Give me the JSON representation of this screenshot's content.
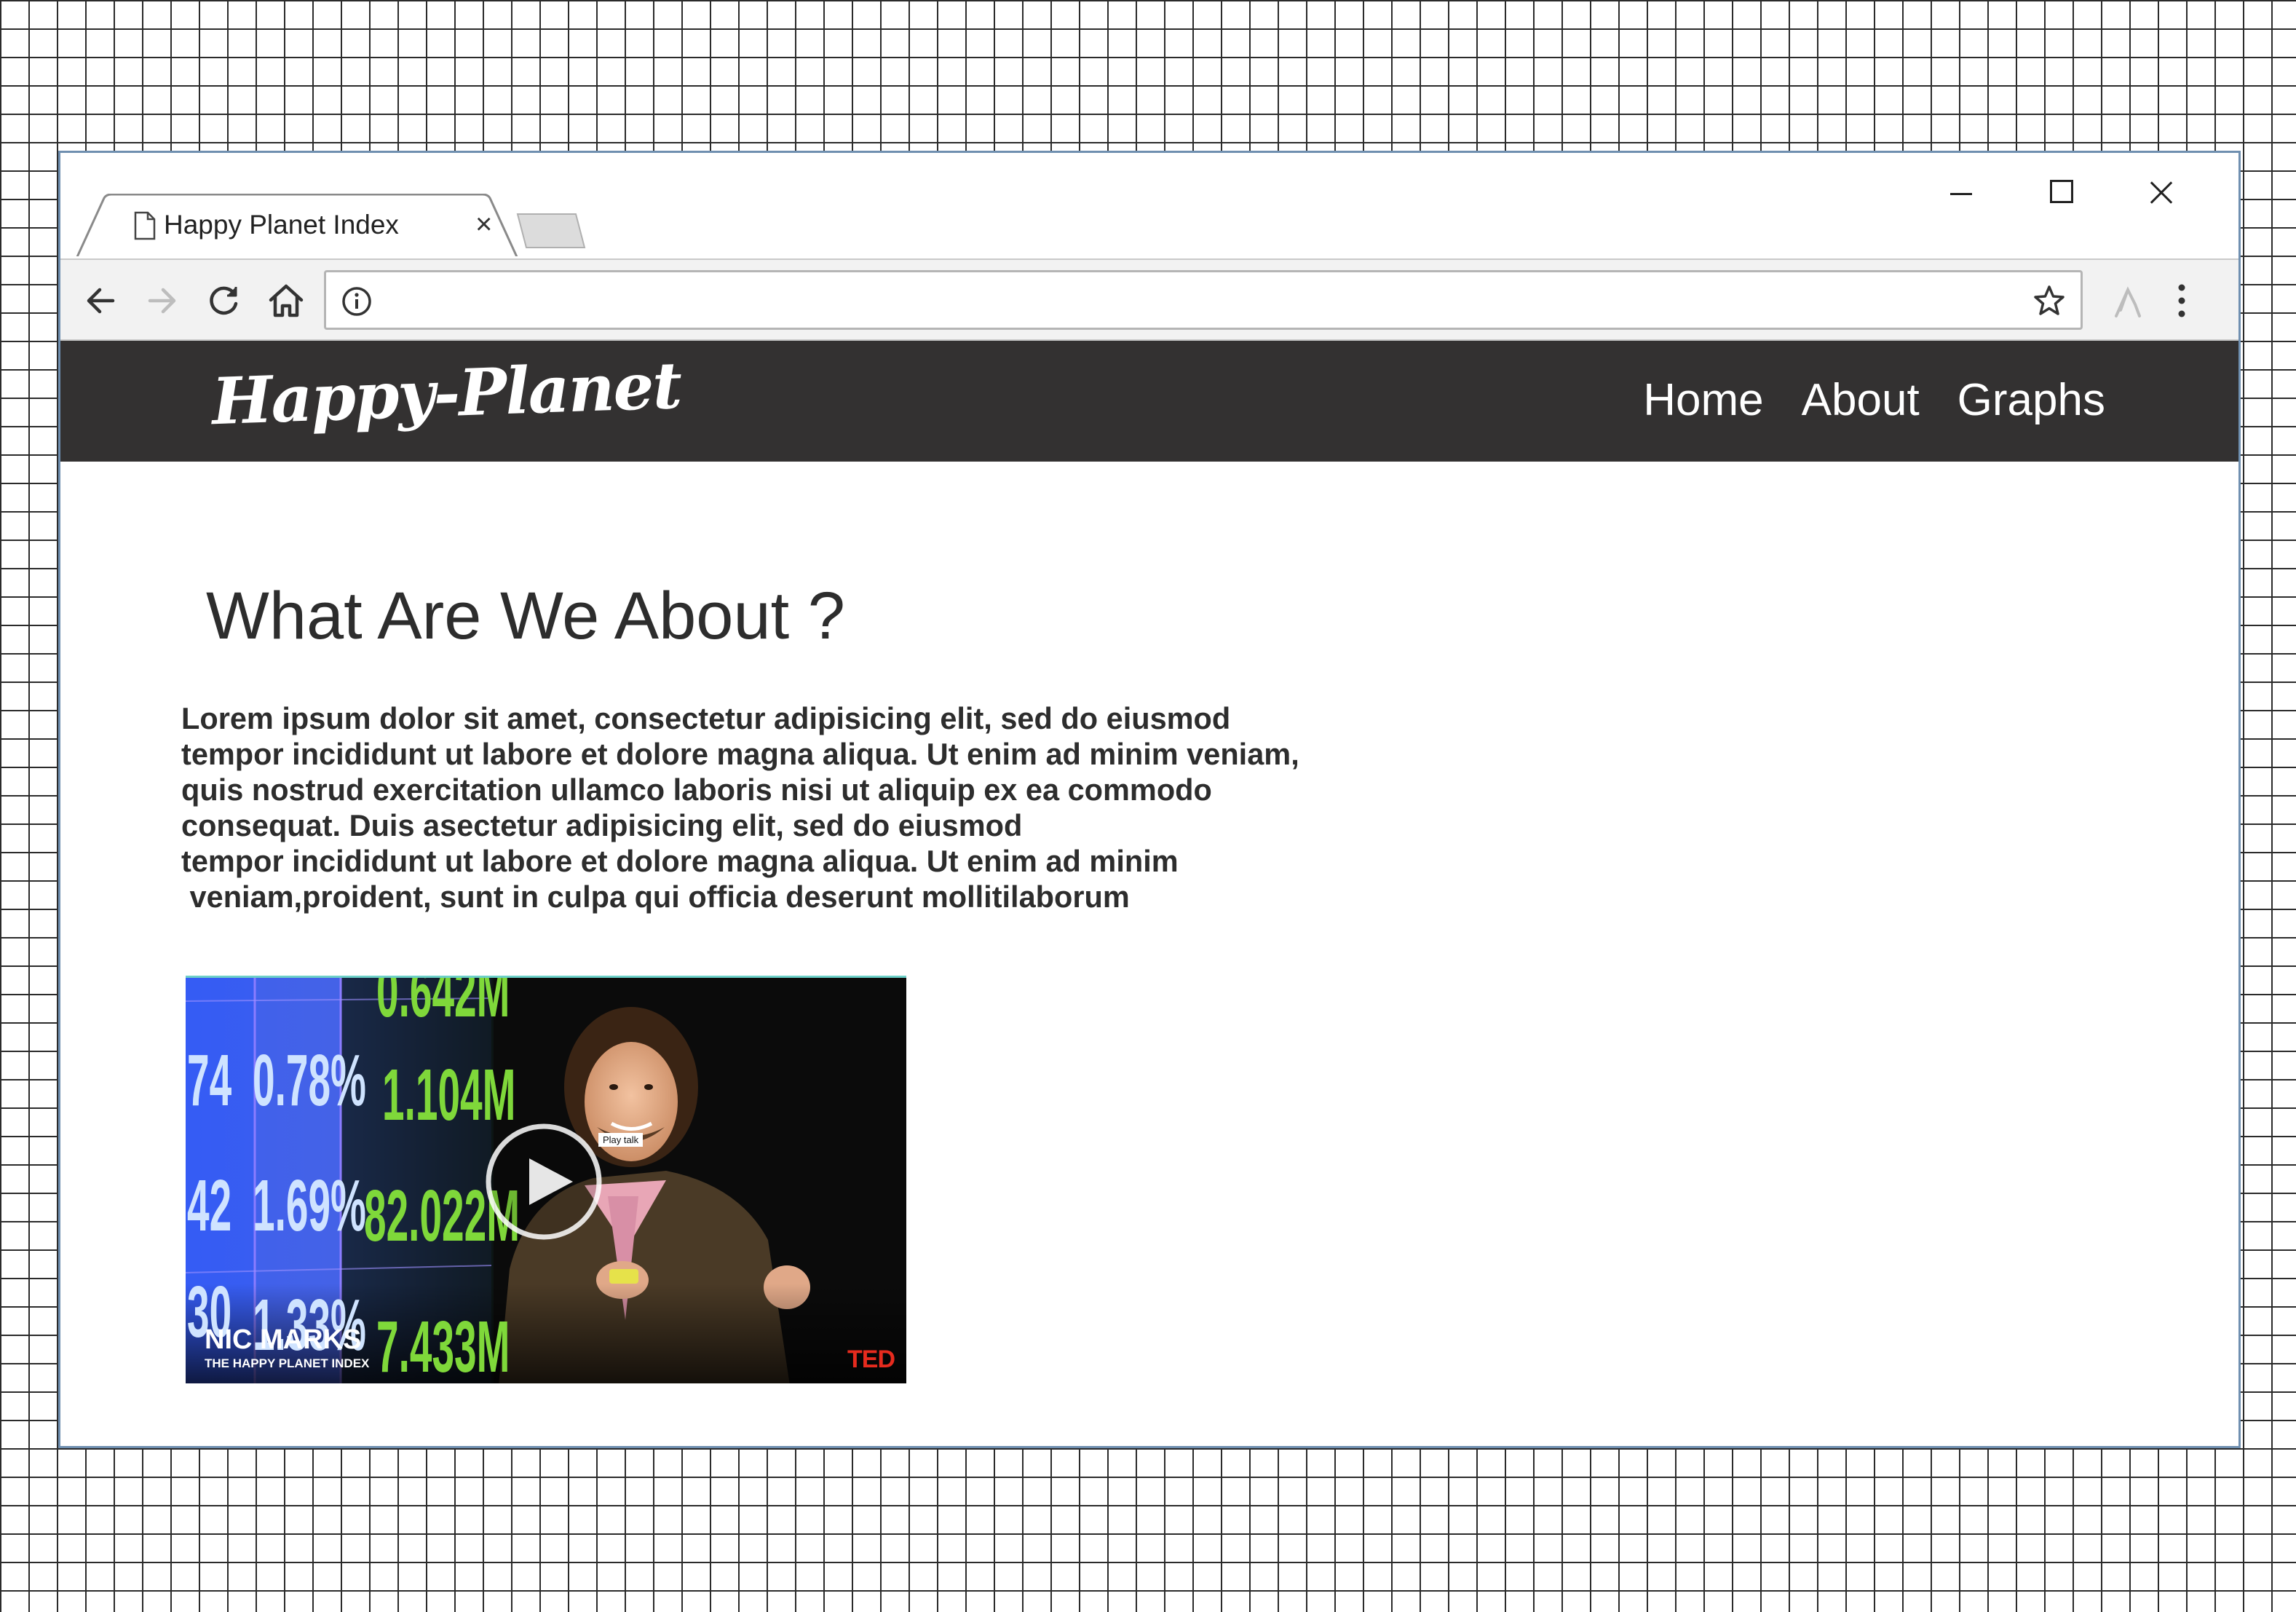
{
  "browser": {
    "tab_title": "Happy Planet Index",
    "tab_close_glyph": "×",
    "address": {
      "value": "",
      "placeholder": ""
    },
    "forward_enabled": false,
    "extension_enabled": false
  },
  "site": {
    "logo": "Happy-Planet",
    "nav": [
      "Home",
      "About",
      "Graphs"
    ]
  },
  "about": {
    "heading": "What Are We About ?",
    "paragraph_lines": [
      "Lorem ipsum dolor sit amet, consectetur adipisicing elit, sed do eiusmod",
      "tempor incididunt ut labore et dolore magna aliqua. Ut enim ad minim veniam,",
      "quis nostrud exercitation ullamco laboris nisi ut aliquip ex ea commodo",
      "consequat. Duis asectetur adipisicing elit, sed do eiusmod",
      "tempor incididunt ut labore et dolore magna aliqua. Ut enim ad minim",
      " veniam,proident, sunt in culpa qui officia deserunt mollitilaborum"
    ]
  },
  "video": {
    "tooltip": "Play talk",
    "speaker_name": "NIC MARKS",
    "speaker_subtitle": "THE HAPPY PLANET INDEX",
    "brand": "TED",
    "ticker": {
      "col1": [
        "74",
        "42",
        "30"
      ],
      "col2": [
        "0.78%",
        "1.69%",
        "1.33%"
      ],
      "col3": [
        "0.642M",
        "1.104M",
        "82.022M",
        "7.433M"
      ]
    }
  },
  "icons": {
    "back": "back-arrow-icon",
    "forward": "forward-arrow-icon",
    "reload": "reload-icon",
    "home": "home-icon",
    "info": "info-icon",
    "star": "star-icon",
    "extension": "extension-icon",
    "menu": "menu-dots-icon",
    "doc": "document-icon",
    "play": "play-icon"
  },
  "colors": {
    "nav_bg": "#333131",
    "nav_text": "#ffffff",
    "text": "#2d2d2d",
    "ticker_blue": "#3c5df0",
    "ticker_green": "#7fd83a",
    "ted_red": "#e62b1e"
  }
}
